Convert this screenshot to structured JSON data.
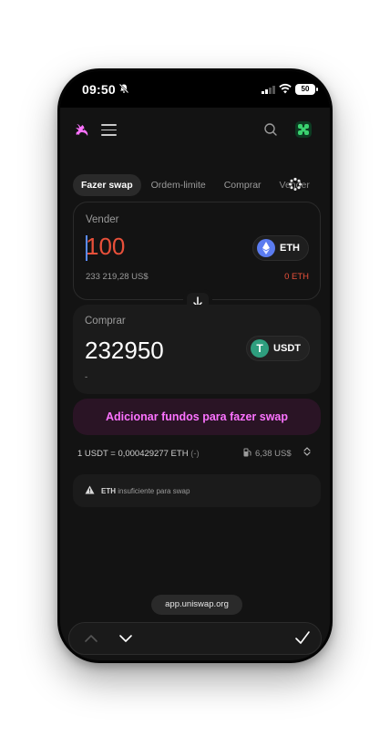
{
  "status_bar": {
    "time": "09:50",
    "battery": "50"
  },
  "tabs": [
    "Fazer swap",
    "Ordem-limite",
    "Comprar",
    "Vender"
  ],
  "sell": {
    "label": "Vender",
    "amount": "100",
    "usd_value": "233 219,28 US$",
    "token": "ETH",
    "balance": "0 ETH"
  },
  "buy": {
    "label": "Comprar",
    "amount": "232950",
    "usd_value": "-",
    "token": "USDT",
    "token_icon_letter": "T"
  },
  "cta_label": "Adicionar fundos para fazer swap",
  "rate": {
    "text": "1 USDT = 0,000429277 ETH",
    "suffix": "(-)"
  },
  "gas_fee": "6,38 US$",
  "warning": {
    "token": "ETH",
    "text": "insuficiente para swap"
  },
  "browser": {
    "url": "app.uniswap.org"
  },
  "colors": {
    "accent_pink": "#fc72ff",
    "error_red": "#e8503a",
    "background": "#131313",
    "surface": "#1b1b1b",
    "eth_blue": "#5b7cf0",
    "usdt_green": "#2e9e7e"
  },
  "icons": [
    "notification-off-icon",
    "uniswap-logo",
    "menu-icon",
    "search-icon",
    "wallet-avatar-icon",
    "eth-icon",
    "usdt-icon",
    "arrow-down-icon",
    "gas-pump-icon",
    "warning-icon",
    "chevron-up-icon",
    "chevron-down-icon",
    "check-icon"
  ]
}
